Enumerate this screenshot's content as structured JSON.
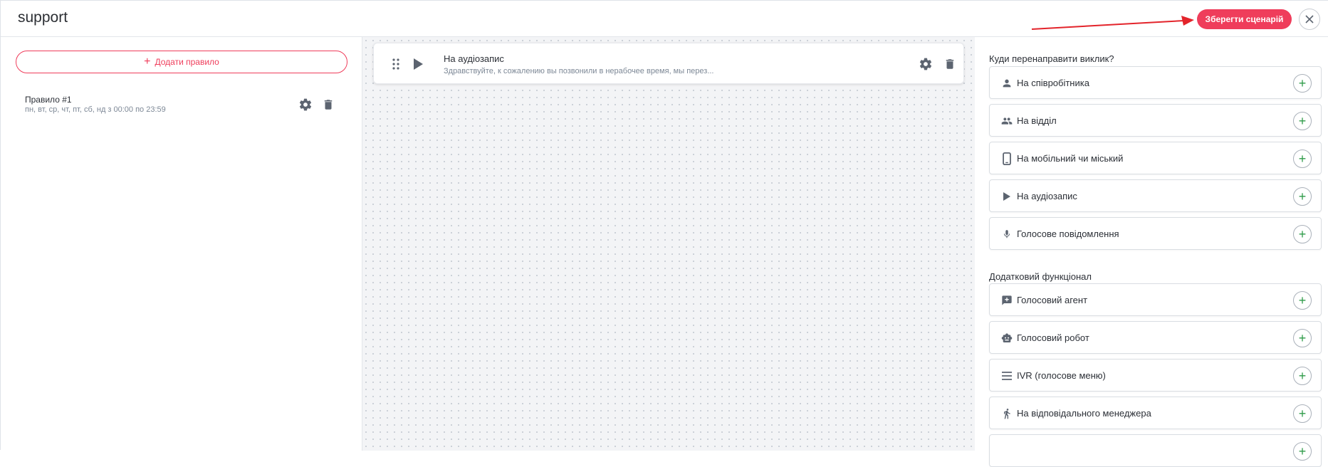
{
  "header": {
    "title": "support",
    "save_label": "Зберегти сценарій"
  },
  "left": {
    "add_rule_label": "Додати правило",
    "rules": [
      {
        "name": "Правило #1",
        "schedule": "пн, вт, ср, чт, пт, сб, нд з 00:00 по 23:59"
      }
    ]
  },
  "canvas": {
    "node": {
      "title": "На аудіозапис",
      "subtitle": "Здравствуйте, к сожалению вы позвонили в нерабочее время, мы перез..."
    }
  },
  "right": {
    "redirect_title": "Куди перенаправити виклик?",
    "redirect_options": [
      {
        "label": "На співробітника",
        "icon": "person-icon"
      },
      {
        "label": "На відділ",
        "icon": "group-icon"
      },
      {
        "label": "На мобільний чи міський",
        "icon": "phone-icon"
      },
      {
        "label": "На аудіозапис",
        "icon": "play-icon"
      },
      {
        "label": "Голосове повідомлення",
        "icon": "mic-icon"
      }
    ],
    "extra_title": "Додатковий функціонал",
    "extra_options": [
      {
        "label": "Голосовий агент",
        "icon": "voice-agent-icon"
      },
      {
        "label": "Голосовий робот",
        "icon": "robot-icon"
      },
      {
        "label": "IVR (голосове меню)",
        "icon": "menu-lines-icon"
      },
      {
        "label": "На відповідального менеджера",
        "icon": "manager-icon"
      }
    ]
  },
  "colors": {
    "accent": "#ef3d5b",
    "add_green": "#2e9b48",
    "icon_gray": "#5c6470"
  }
}
